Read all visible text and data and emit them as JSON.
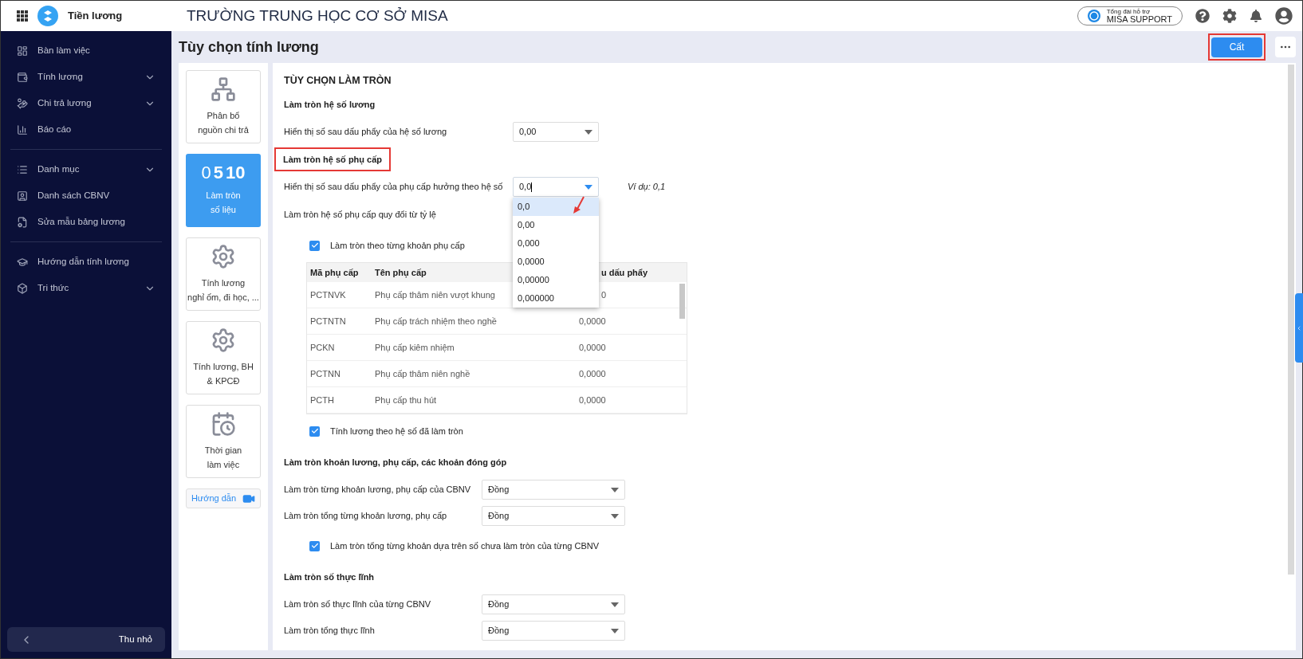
{
  "topbar": {
    "app_name": "Tiền lương",
    "school": "TRƯỜNG TRUNG HỌC CƠ SỞ MISA",
    "support_caption": "Tổng đài hỗ trợ",
    "support_label": "MISA SUPPORT"
  },
  "sidebar": {
    "groups": [
      [
        {
          "label": "Bàn làm việc",
          "expandable": false
        },
        {
          "label": "Tính lương",
          "expandable": true
        },
        {
          "label": "Chi trả lương",
          "expandable": true
        },
        {
          "label": "Báo cáo",
          "expandable": false
        }
      ],
      [
        {
          "label": "Danh mục",
          "expandable": true
        },
        {
          "label": "Danh sách CBNV",
          "expandable": false
        },
        {
          "label": "Sửa mẫu bảng lương",
          "expandable": false
        }
      ],
      [
        {
          "label": "Hướng dẫn tính lương",
          "expandable": false
        },
        {
          "label": "Tri thức",
          "expandable": true
        }
      ]
    ],
    "collapse": "Thu nhỏ"
  },
  "page": {
    "title": "Tùy chọn tính lương",
    "save": "Cất"
  },
  "option_cards": [
    {
      "kind": "tree",
      "lines": [
        "Phân bổ",
        "nguồn chi trả"
      ],
      "selected": false
    },
    {
      "kind": "digits",
      "digits": [
        "0",
        "5",
        "10"
      ],
      "lines": [
        "Làm tròn",
        "số liệu"
      ],
      "selected": true
    },
    {
      "kind": "gear",
      "lines": [
        "Tính lương",
        "nghỉ ốm, đi học, ..."
      ],
      "selected": false
    },
    {
      "kind": "gearplus",
      "lines": [
        "Tính lương, BH",
        "& KPCĐ"
      ],
      "selected": false
    },
    {
      "kind": "calendar",
      "lines": [
        "Thời gian",
        "làm việc"
      ],
      "selected": false
    }
  ],
  "guide_link": "Hướng dẫn",
  "content": {
    "title": "TÙY CHỌN LÀM TRÒN",
    "blocks": [
      {
        "kind": "heading",
        "text": "Làm tròn hệ số lương",
        "highlighted": false
      },
      {
        "kind": "decimal_select",
        "label": "Hiển thị số sau dấu phẩy của hệ số lương",
        "value": "0,00",
        "focused": false
      },
      {
        "kind": "heading",
        "text": "Làm tròn hệ số phụ cấp",
        "highlighted": true
      },
      {
        "kind": "decimal_select",
        "label": "Hiển thị số sau dấu phẩy của phụ cấp hưởng theo hệ số",
        "value": "0,0",
        "focused": true,
        "example": "Ví dụ: 0,1",
        "options": [
          {
            "label": "0,0",
            "selected": true
          },
          {
            "label": "0,00",
            "selected": false
          },
          {
            "label": "0,000",
            "selected": false
          },
          {
            "label": "0,0000",
            "selected": false
          },
          {
            "label": "0,00000",
            "selected": false
          },
          {
            "label": "0,000000",
            "selected": false
          }
        ]
      },
      {
        "kind": "text",
        "text": "Làm tròn hệ số phụ cấp quy đổi từ tỷ lệ"
      },
      {
        "kind": "checkbox",
        "label": "Làm tròn theo từng khoản phụ cấp",
        "checked": true
      },
      {
        "kind": "table",
        "columns": [
          {
            "label": "Mã phụ cấp"
          },
          {
            "label": "Tên phụ cấp"
          },
          {
            "label": "u dấu phẩy",
            "clipped": true
          }
        ],
        "rows": [
          [
            {
              "text": "PCTNVK"
            },
            {
              "text": "Phụ cấp thâm niên vượt khung"
            },
            {
              "text": "0",
              "clipped": true
            }
          ],
          [
            {
              "text": "PCTNTN"
            },
            {
              "text": "Phụ cấp trách nhiệm theo nghề"
            },
            {
              "text": "0,0000"
            }
          ],
          [
            {
              "text": "PCKN"
            },
            {
              "text": "Phụ cấp kiêm nhiệm"
            },
            {
              "text": "0,0000"
            }
          ],
          [
            {
              "text": "PCTNN"
            },
            {
              "text": "Phụ cấp thâm niên nghề"
            },
            {
              "text": "0,0000"
            }
          ],
          [
            {
              "text": "PCTH"
            },
            {
              "text": "Phụ cấp thu hút"
            },
            {
              "text": "0,0000"
            }
          ]
        ]
      },
      {
        "kind": "checkbox",
        "label": "Tính lương theo hệ số đã làm tròn",
        "checked": true
      },
      {
        "kind": "heading",
        "text": "Làm tròn khoản lương, phụ cấp, các khoản đóng góp",
        "highlighted": false
      },
      {
        "kind": "unit_select",
        "label": "Làm tròn từng khoản lương, phụ cấp của CBNV",
        "value": "Đồng"
      },
      {
        "kind": "unit_select",
        "label": "Làm tròn tổng từng khoản lương, phụ cấp",
        "value": "Đồng"
      },
      {
        "kind": "checkbox",
        "label": "Làm tròn tổng từng khoản dựa trên số chưa làm tròn của từng CBNV",
        "checked": true
      },
      {
        "kind": "heading",
        "text": "Làm tròn số thực lĩnh",
        "highlighted": false
      },
      {
        "kind": "unit_select",
        "label": "Làm tròn số thực lĩnh của từng CBNV",
        "value": "Đồng"
      },
      {
        "kind": "unit_select",
        "label": "Làm tròn tổng thực lĩnh",
        "value": "Đồng"
      }
    ]
  }
}
